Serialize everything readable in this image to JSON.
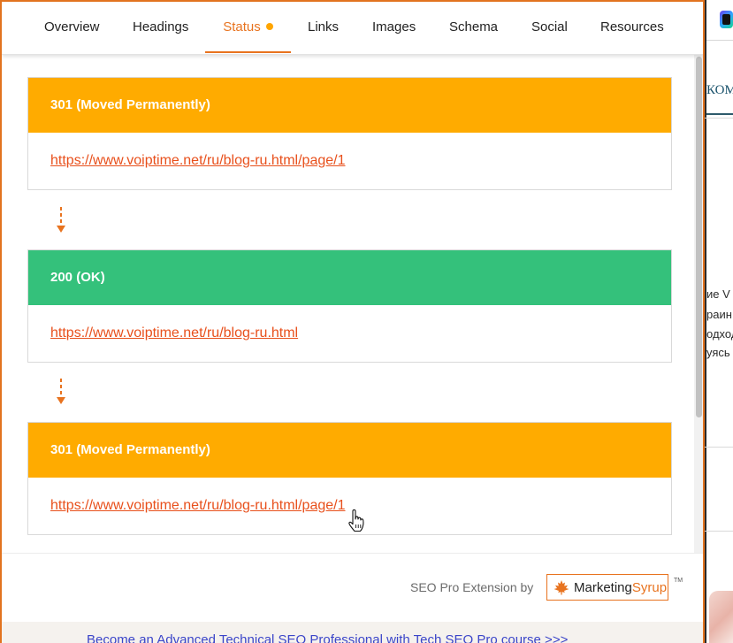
{
  "tabs": [
    {
      "label": "Overview"
    },
    {
      "label": "Headings"
    },
    {
      "label": "Status"
    },
    {
      "label": "Links"
    },
    {
      "label": "Images"
    },
    {
      "label": "Schema"
    },
    {
      "label": "Social"
    },
    {
      "label": "Resources"
    }
  ],
  "active_tab": "Status",
  "redirect_chain": [
    {
      "status": "301 (Moved Permanently)",
      "url": "https://www.voiptime.net/ru/blog-ru.html/page/1"
    },
    {
      "status": "200 (OK)",
      "url": "https://www.voiptime.net/ru/blog-ru.html"
    },
    {
      "status": "301 (Moved Permanently)",
      "url": "https://www.voiptime.net/ru/blog-ru.html/page/1"
    }
  ],
  "footer": {
    "credit": "SEO Pro Extension by",
    "brand_part1": "Marketing",
    "brand_part2": "Syrup",
    "trademark": "TM"
  },
  "promo": {
    "link_text": "Become an Advanced Technical SEO Professional with Tech SEO Pro course >>>"
  },
  "background_page": {
    "header_text": "КОМ",
    "text_lines": [
      "ие V",
      "раин",
      "одход",
      "уясь"
    ]
  },
  "colors": {
    "accent": "#e8731f",
    "redirect": "#ffab00",
    "ok": "#34c17b",
    "link": "#e8501c",
    "promo_link": "#3b45c9"
  }
}
